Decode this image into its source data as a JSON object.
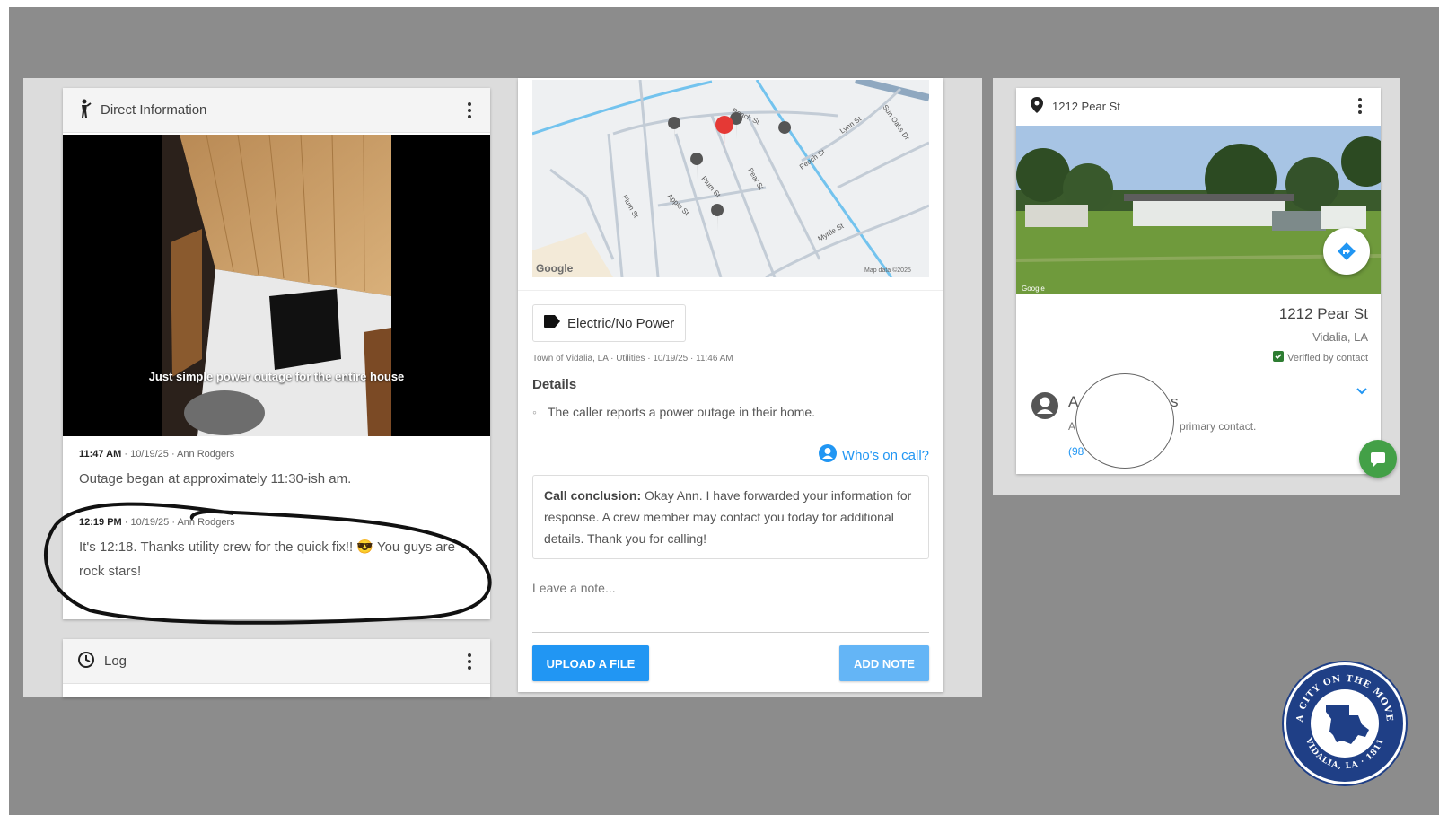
{
  "left_card": {
    "title": "Direct Information",
    "photo_caption": "Just simple power outage for the entire house",
    "entries": [
      {
        "time": "11:47 AM",
        "meta": " · 10/19/25 · Ann Rodgers",
        "text": "Outage began at approximately 11:30-ish am."
      },
      {
        "time": "12:19 PM",
        "meta": " · 10/19/25 · Ann Rodgers",
        "text": "It's 12:18. Thanks utility crew for the quick fix!! 😎 You guys are rock stars!"
      }
    ]
  },
  "log_card": {
    "title": "Log"
  },
  "center_card": {
    "map_streets": [
      "Peach St",
      "Plum St",
      "Pear St",
      "Apple St",
      "Plum St",
      "Peach St",
      "Lynn St",
      "Myrtle St",
      "Sun Oaks Dr"
    ],
    "map_google": "Google",
    "map_attribution": "Map data ©2025",
    "category": "Electric/No Power",
    "source_line": "Town of Vidalia, LA · Utilities · 10/19/25 · 11:46 AM",
    "details_heading": "Details",
    "details_item": "The caller reports a power outage in their home.",
    "whos_on_call": "Who's on call?",
    "conclusion_label": "Call conclusion:",
    "conclusion_text": " Okay Ann. I have forwarded your information for response. A crew member may contact you today for additional details. Thank you for calling!",
    "note_placeholder": "Leave a note...",
    "upload_label": "UPLOAD A FILE",
    "add_note_label": "ADD NOTE"
  },
  "right_card": {
    "header_address": "1212 Pear St",
    "photo_google": "Google",
    "address_line1": "1212 Pear St",
    "address_line2": "Vidalia, LA",
    "verified": "Verified by contact",
    "contact_initial": "A",
    "contact_suffix": "s",
    "contact_line2_prefix": "A",
    "contact_role": "primary contact.",
    "contact_phone_prefix": "(98"
  },
  "seal": {
    "top_text": "A CITY ON THE MOVE",
    "bottom_text": "VIDALIA, LA · 1811"
  },
  "colors": {
    "accent_blue": "#2196f3",
    "accent_blue_light": "#64b5f6",
    "verified_green": "#2e7d32",
    "chat_green": "#43a047",
    "pin_red": "#e53935",
    "seal_blue": "#1f3f86"
  },
  "icons": [
    "person-icon",
    "kebab-icon",
    "clock-icon",
    "location-pin-icon",
    "tag-icon",
    "account-icon",
    "directions-icon",
    "chevron-down-icon",
    "verified-check-icon",
    "chat-icon",
    "louisiana-seal-icon"
  ]
}
